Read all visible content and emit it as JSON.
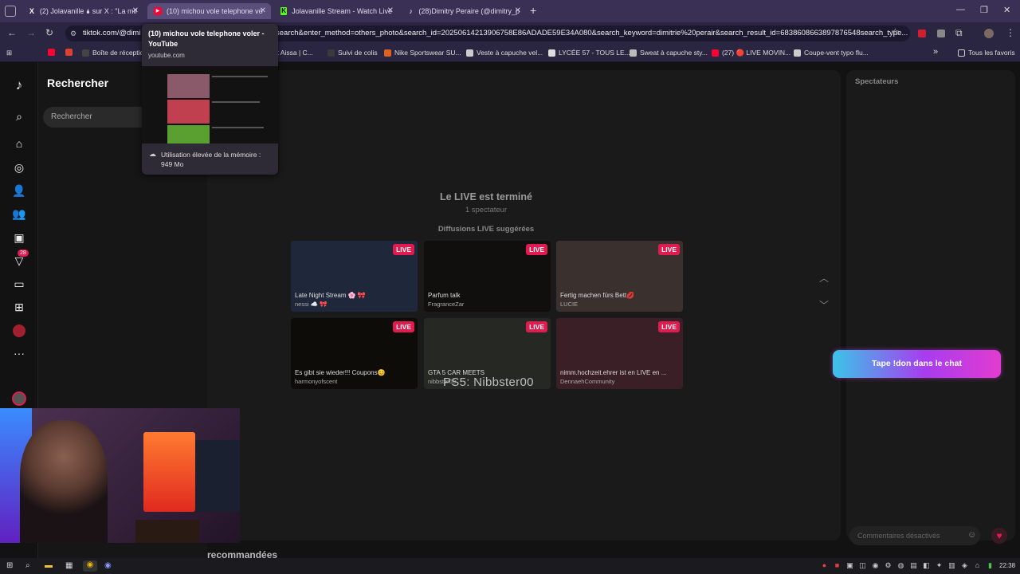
{
  "browser": {
    "tabs": [
      {
        "label": "(2) Jolavanille 🌢 sur X : \"La mif",
        "icon": "x-logo-icon"
      },
      {
        "label": "(10) michou vole telephone vo",
        "icon": "youtube-icon",
        "active": true
      },
      {
        "label": "Jolavanille Stream - Watch Live",
        "icon": "kick-icon"
      },
      {
        "label": "(28)Dimitry Peraire (@dimitry_p",
        "icon": "tiktok-icon"
      }
    ],
    "new_tab": "+",
    "address": "tiktok.com/@dimi",
    "address_tail": "search&enter_method=others_photo&search_id=20250614213906758E86ADADE59E34A080&search_keyword=dimitrie%20perair&search_result_id=6838608663897876548search_type...",
    "bookmarks": [
      "Boîte de réception",
      "Ait Aissa | C...",
      "Suivi de colis",
      "Nike Sportswear SU...",
      "Veste à capuche vel...",
      "LYCÉE 57 - TOUS LE...",
      "Sweat à capuche sty...",
      "(27) 🔴 LIVE MOVIN...",
      "Coupe-vent typo flu..."
    ],
    "all_bookmarks": "Tous les favoris",
    "overflow": "»"
  },
  "tooltip": {
    "title": "(10) michou vole telephone voler - YouTube",
    "domain": "youtube.com",
    "memory": "Utilisation élevée de la mémoire : 949 Mo"
  },
  "tiktok": {
    "search_title": "Rechercher",
    "search_placeholder": "Rechercher",
    "inbox_badge": "28",
    "more": "···",
    "live_ended": "Le LIVE est terminé",
    "viewer_count": "1 spectateur",
    "suggested_title": "Diffusions LIVE suggérées",
    "live_badge": "LIVE",
    "cards": [
      {
        "title": "Late Night Stream 🌸 🎀",
        "user": "nessi ☁️ 🎀",
        "bg": "#3a4a6a"
      },
      {
        "title": "Parfum talk",
        "user": "FragranceZar",
        "bg": "#1e1c18"
      },
      {
        "title": "Fertig machen fürs Bett💋",
        "user": "LUCIE",
        "bg": "#6a5a55"
      },
      {
        "title": "Es gibt sie wieder!!! Coupons😊",
        "user": "harmonyofscent",
        "bg": "#1a160f"
      },
      {
        "title": "GTA 5 CAR MEETS",
        "user": "nibbster00",
        "bg": "#454a40"
      },
      {
        "title": "nimm.hochzeit.ehrer ist en LIVE en ...",
        "user": "DennaehCommunity",
        "bg": "#6a3a45"
      }
    ],
    "overlay_text": "PS5: Nibbster00",
    "viewers_title": "Spectateurs",
    "don_button": "Tape !don dans le chat",
    "comments_disabled": "Commentaires désactivés",
    "recommended": "recommandées"
  },
  "taskbar": {
    "clock": "22:38"
  },
  "colors": {
    "accent_live": "#e01b4f",
    "don_gradient_start": "#3ac5e8",
    "don_gradient_end": "#e23ccf"
  }
}
